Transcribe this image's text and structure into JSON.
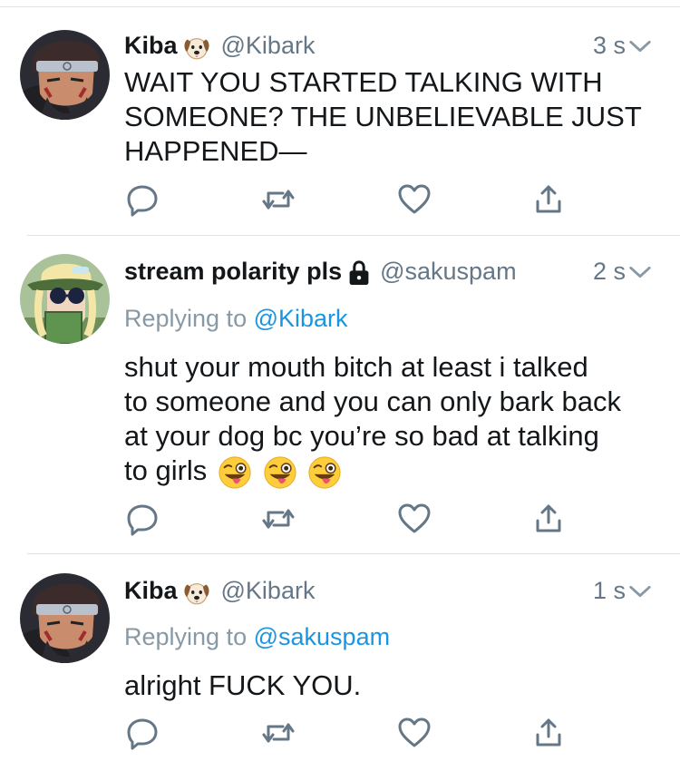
{
  "tweets": [
    {
      "name": "Kiba",
      "name_emoji": "dog-face-emoji",
      "handle": "@Kibark",
      "time": "3 s",
      "replying_label": "",
      "replying_handle": "",
      "body": [
        "WAIT YOU STARTED TALKING WITH",
        "SOMEONE? THE UNBELIEVABLE JUST",
        "HAPPENED—"
      ]
    },
    {
      "name": "stream polarity pls",
      "name_emoji": "lock-icon",
      "handle": "@sakuspam",
      "time": "2 s",
      "replying_label": "Replying to",
      "replying_handle": "@Kibark",
      "body": [
        "shut your mouth bitch at least i talked",
        "to someone and you can only bark back",
        "at your dog bc you’re so bad at talking",
        "to girls"
      ],
      "body_emoji": "winking-face-with-tongue-emoji",
      "body_emoji_count": 3
    },
    {
      "name": "Kiba",
      "name_emoji": "dog-face-emoji",
      "handle": "@Kibark",
      "time": "1 s",
      "replying_label": "Replying to",
      "replying_handle": "@sakuspam",
      "body": [
        "alright FUCK YOU."
      ]
    }
  ],
  "actions": [
    "reply-icon",
    "retweet-icon",
    "like-icon",
    "share-icon"
  ],
  "colors": {
    "text": "#14171a",
    "secondary": "#657786",
    "reply_gray": "#8899a6",
    "link": "#1b95e0",
    "divider": "#dfe3e6",
    "icon": "#657786"
  }
}
